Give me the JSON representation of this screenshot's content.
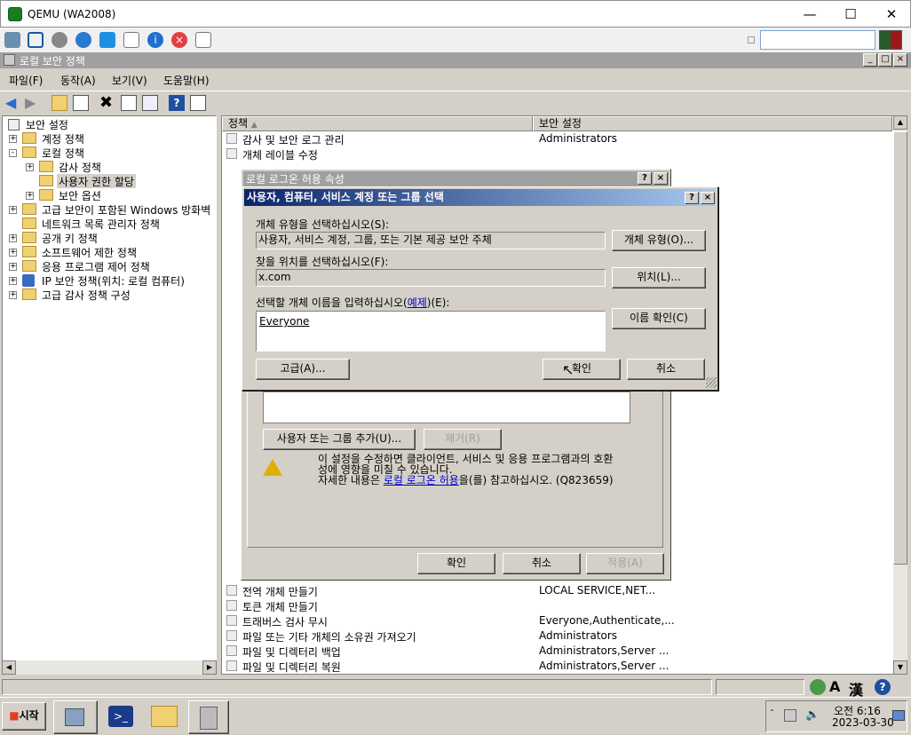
{
  "window": {
    "title": "QEMU (WA2008)"
  },
  "mmc": {
    "title": "로컬 보안 정책"
  },
  "menu": [
    "파일(F)",
    "동작(A)",
    "보기(V)",
    "도움말(H)"
  ],
  "tree": {
    "root": "보안 설정",
    "account": "계정 정책",
    "local": "로컬 정책",
    "audit": "감사 정책",
    "rights": "사용자 권한 할당",
    "options": "보안 옵션",
    "firewall": "고급 보안이 포함된 Windows 방화벽",
    "netlist": "네트워크 목록 관리자 정책",
    "pubkey": "공개 키 정책",
    "srp": "소프트웨어 제한 정책",
    "applocker": "응용 프로그램 제어 정책",
    "ipsec": "IP 보안 정책(위치: 로컬 컴퓨터)",
    "advaudit": "고급 감사 정책 구성"
  },
  "list": {
    "col_policy": "정책",
    "col_setting": "보안 설정",
    "top_rows": [
      {
        "name": "감사 및 보안 로그 관리",
        "value": "Administrators"
      },
      {
        "name": "개체 레이블 수정",
        "value": ""
      }
    ],
    "bottom_rows": [
      {
        "name": "전역 개체 만들기",
        "value": "LOCAL SERVICE,NET..."
      },
      {
        "name": "토큰 개체 만들기",
        "value": ""
      },
      {
        "name": "트래버스 검사 무시",
        "value": "Everyone,Authenticate,..."
      },
      {
        "name": "파일 또는 기타 개체의 소유권 가져오기",
        "value": "Administrators"
      },
      {
        "name": "파일 및 디렉터리 백업",
        "value": "Administrators,Server ..."
      },
      {
        "name": "파일 및 디렉터리 복원",
        "value": "Administrators,Server ..."
      }
    ]
  },
  "props": {
    "title": "로컬 로그온 허용 속성",
    "add_btn": "사용자 또는 그룹 추가(U)...",
    "remove_btn": "제거(R)",
    "warn1": "이 설정을 수정하면 클라이언트, 서비스 및 응용 프로그램과의 호환",
    "warn2": "성에 영향을 미칠 수 있습니다.",
    "warn3a": "자세한 내용은 ",
    "warn3link": "로컬 로그온 허용",
    "warn3b": "을(를) 참고하십시오. (Q823659)",
    "ok": "확인",
    "cancel": "취소",
    "apply": "적용(A)"
  },
  "select": {
    "title": "사용자, 컴퓨터, 서비스 계정 또는 그룹 선택",
    "type_label": "개체 유형을 선택하십시오(S):",
    "type_value": "사용자, 서비스 계정, 그룹, 또는 기본 제공 보안 주체",
    "type_btn": "개체 유형(O)...",
    "loc_label": "찾을 위치를 선택하십시오(F):",
    "loc_value": "x.com",
    "loc_btn": "위치(L)...",
    "name_label": "선택할 개체 이름을 입력하십시오(",
    "name_link": "예제",
    "name_label2": ")(E):",
    "name_value": "Everyone",
    "check_btn": "이름 확인(C)",
    "advanced_btn": "고급(A)...",
    "ok": "확인",
    "cancel": "취소"
  },
  "taskbar": {
    "start": "시작",
    "time": "오전 6:16",
    "date": "2023-03-30"
  }
}
